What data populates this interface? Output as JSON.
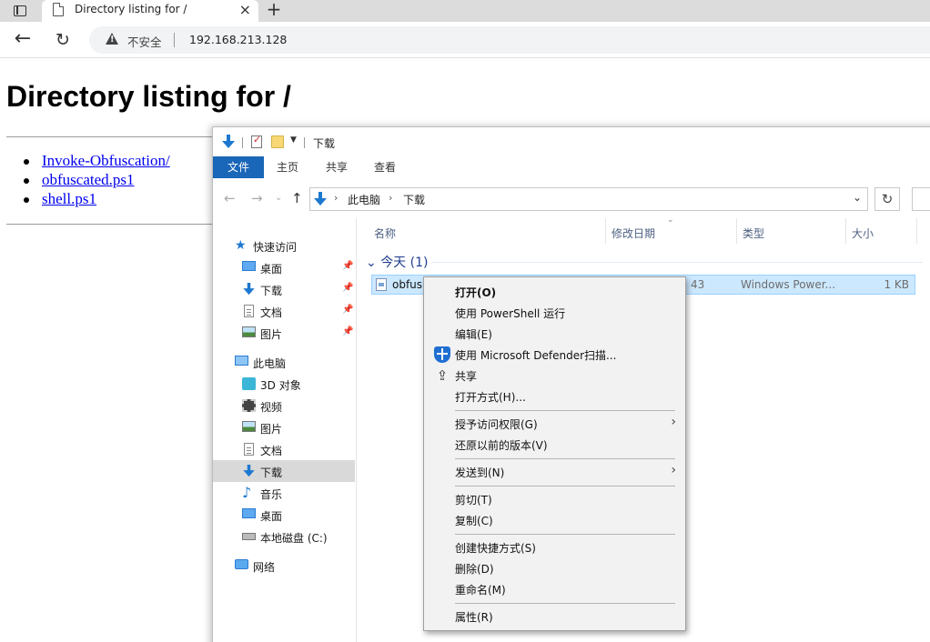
{
  "browser": {
    "tab_title": "Directory listing for /",
    "tab_close": "×",
    "new_tab": "+",
    "back": "←",
    "reload": "↻",
    "security_label": "不安全",
    "url": "192.168.213.128"
  },
  "page": {
    "heading": "Directory listing for /",
    "links": [
      "Invoke-Obfuscation/",
      "obfuscated.ps1",
      "shell.ps1"
    ]
  },
  "explorer": {
    "qat_title": "下载",
    "ribbon_tabs": [
      "文件",
      "主页",
      "共享",
      "查看"
    ],
    "breadcrumb": [
      "此电脑",
      "下载"
    ],
    "nav_pane": {
      "quick_access": "快速访问",
      "quick_items": [
        "桌面",
        "下载",
        "文档",
        "图片"
      ],
      "this_pc": "此电脑",
      "pc_items": [
        "3D 对象",
        "视频",
        "图片",
        "文档",
        "下载",
        "音乐",
        "桌面",
        "本地磁盘 (C:)"
      ],
      "network": "网络",
      "selected": "下载"
    },
    "columns": [
      "名称",
      "修改日期",
      "类型",
      "大小"
    ],
    "group_header": "今天 (1)",
    "file": {
      "name": "obfus",
      "date_fragment": "43",
      "type": "Windows Power...",
      "size": "1 KB"
    }
  },
  "context_menu": {
    "items": [
      {
        "label": "打开(O)",
        "bold": true
      },
      {
        "label": "使用 PowerShell 运行"
      },
      {
        "label": "编辑(E)"
      },
      {
        "label": "使用 Microsoft Defender扫描...",
        "icon": "defender-shield-icon"
      },
      {
        "label": "共享",
        "icon": "share-icon"
      },
      {
        "label": "打开方式(H)..."
      },
      {
        "label": "授予访问权限(G)",
        "submenu": true
      },
      {
        "label": "还原以前的版本(V)"
      },
      {
        "label": "发送到(N)",
        "submenu": true
      },
      {
        "label": "剪切(T)"
      },
      {
        "label": "复制(C)"
      },
      {
        "label": "创建快捷方式(S)"
      },
      {
        "label": "删除(D)"
      },
      {
        "label": "重命名(M)"
      },
      {
        "label": "属性(R)"
      }
    ]
  },
  "colors": {
    "ribbon_file_tab": "#1a66b8",
    "selection": "#cce8ff",
    "link": "#0000ee"
  }
}
